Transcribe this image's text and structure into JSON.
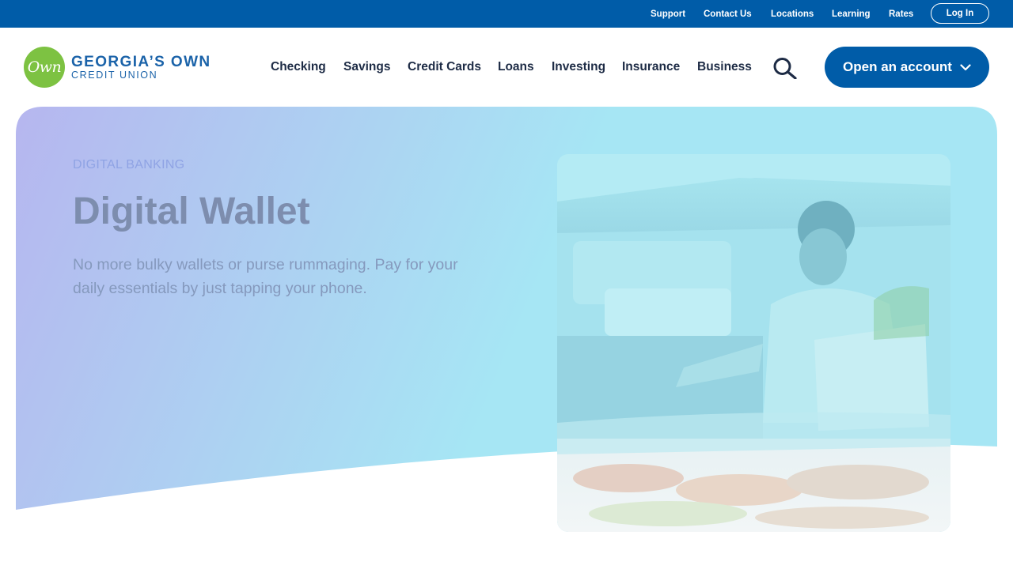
{
  "utility_nav": {
    "links": [
      "Support",
      "Contact Us",
      "Locations",
      "Learning",
      "Rates"
    ],
    "login_label": "Log In"
  },
  "brand": {
    "logo_mark": "Own",
    "name_line1": "GEORGIA’S OWN",
    "name_line2": "CREDIT UNION",
    "colors": {
      "primary": "#005ca8",
      "logo_green": "#7dc242",
      "nav_text": "#1d2b45"
    }
  },
  "main_nav": {
    "items": [
      "Checking",
      "Savings",
      "Credit Cards",
      "Loans",
      "Investing",
      "Insurance",
      "Business"
    ],
    "search_icon": "search-icon",
    "cta_label": "Open an account",
    "cta_icon": "chevron-down-icon"
  },
  "hero": {
    "eyebrow": "DIGITAL BANKING",
    "title": "Digital Wallet",
    "subtitle": "No more bulky wallets or purse rummaging. Pay for your daily essentials by just tapping your phone.",
    "gradient": {
      "start": "#b6b6ef",
      "end": "#a6e6f4"
    }
  }
}
